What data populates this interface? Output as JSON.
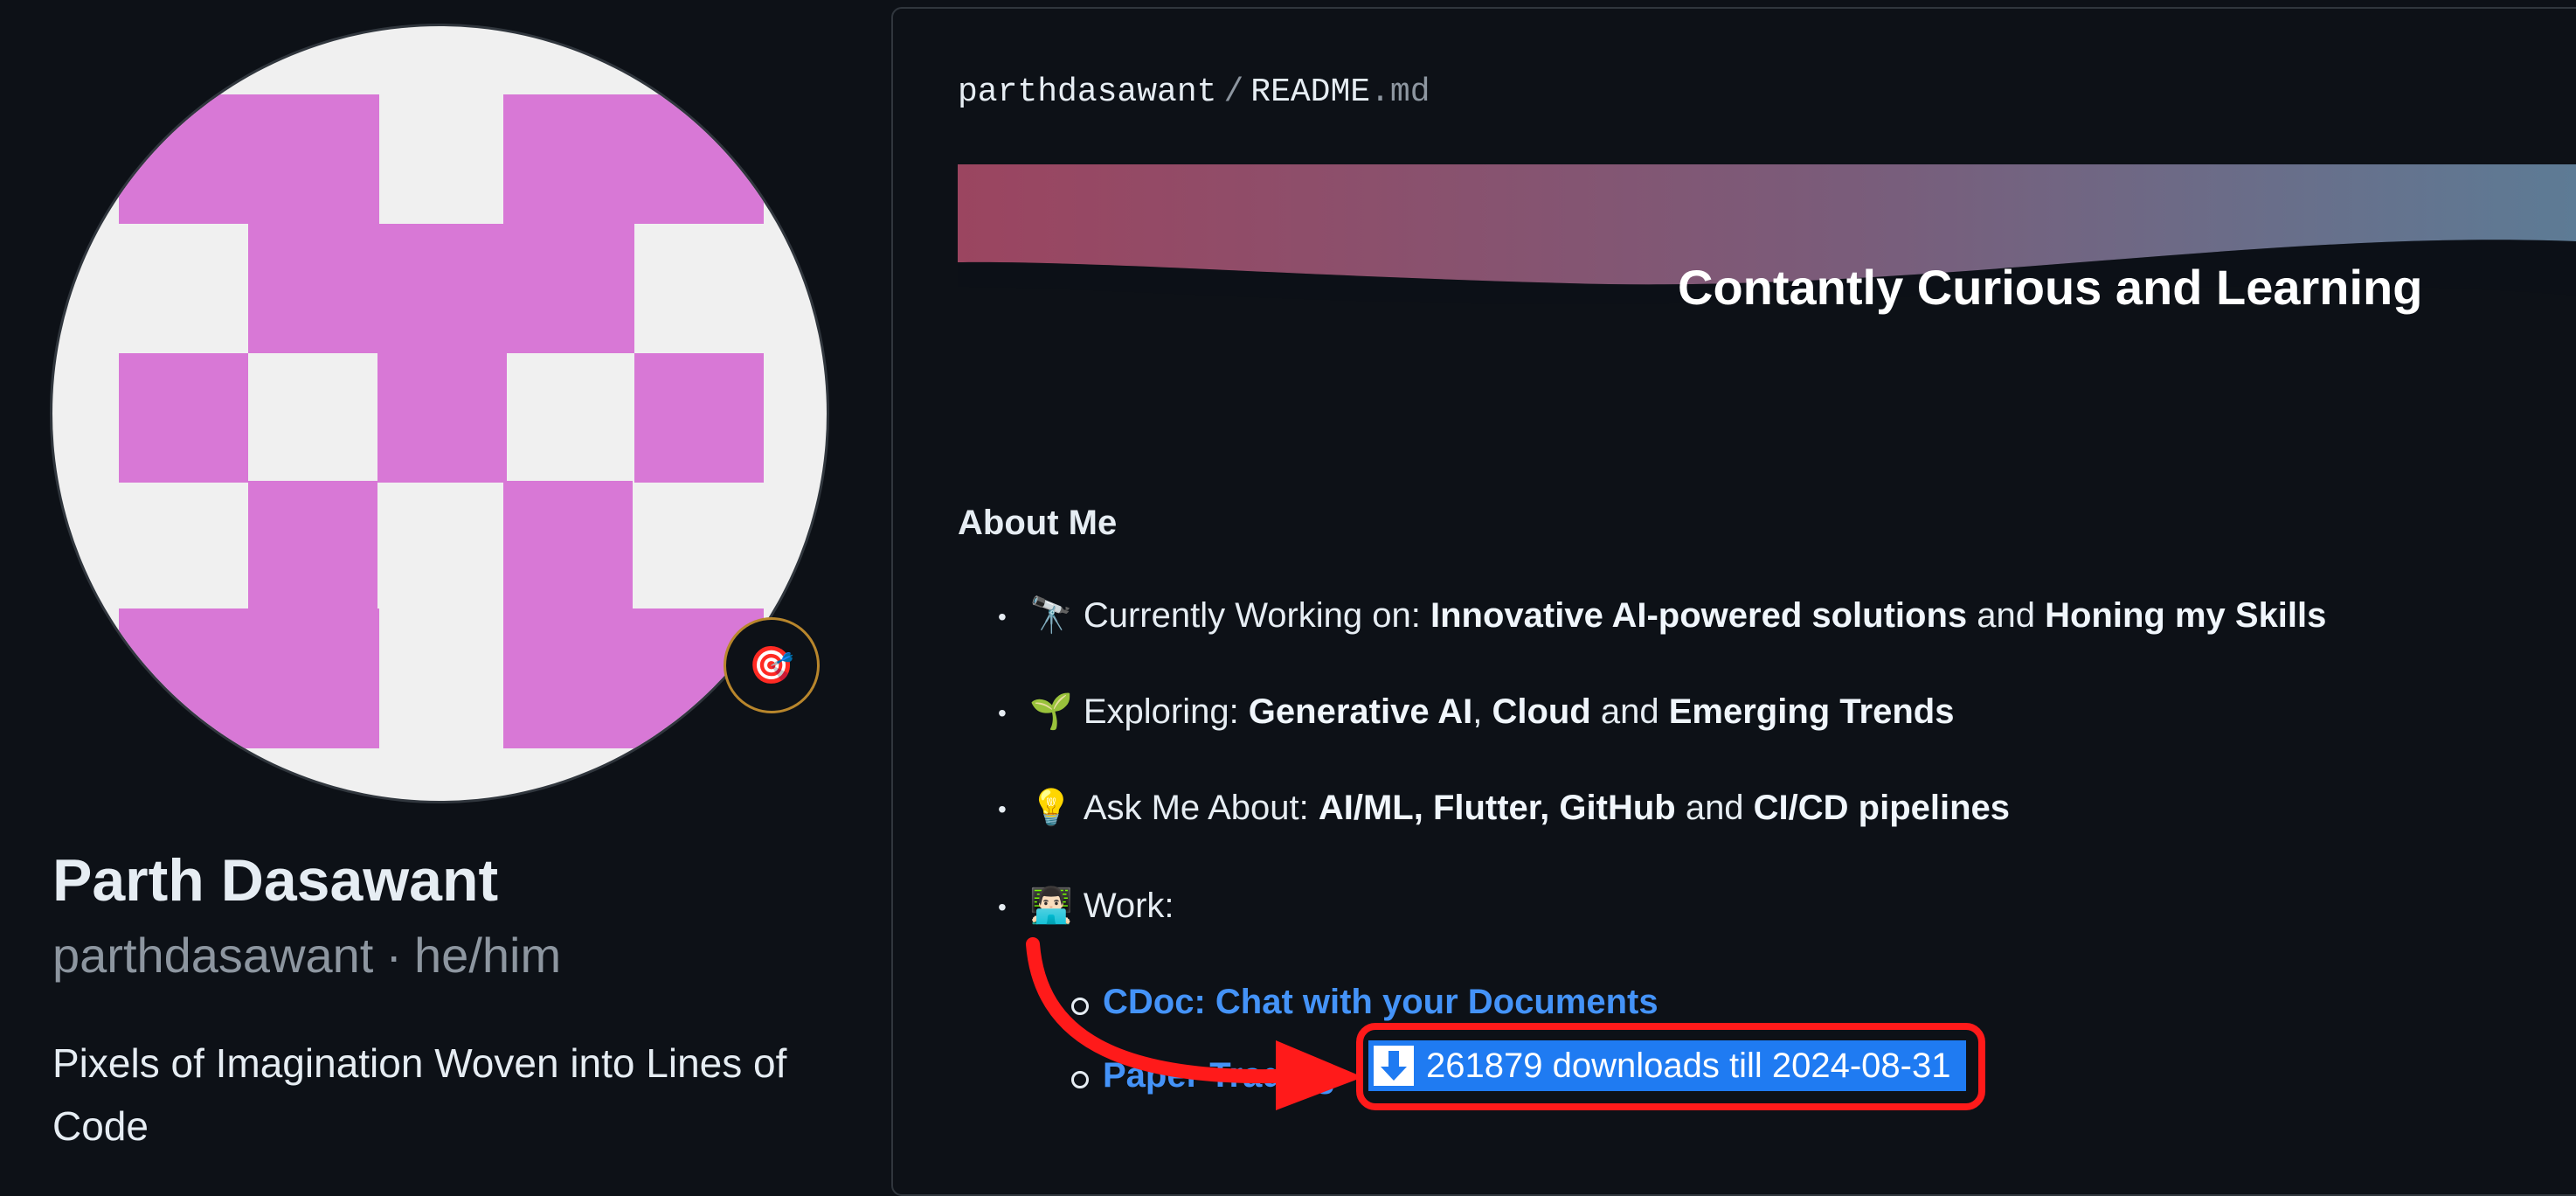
{
  "profile": {
    "name": "Parth Dasawant",
    "login": "parthdasawant",
    "pronouns": "he/him",
    "separator": "·",
    "bio": "Pixels of Imagination Woven into Lines of Code",
    "status_emoji": "🎯",
    "avatar_colors": {
      "fill": "#d878d6",
      "background": "#f0f0f0"
    }
  },
  "readme": {
    "owner": "parthdasawant",
    "slash": "/",
    "filename": "README",
    "extension": ".md",
    "banner_title": "Contantly Curious and Learning",
    "banner_colors": [
      "#9b4560",
      "#7a5c7a",
      "#5d7b95"
    ],
    "about_heading": "About Me",
    "items": [
      {
        "emoji": "🔭",
        "prefix": "Currently Working on: ",
        "b1": "Innovative AI-powered solutions",
        "mid1": " and ",
        "b2": "Honing my Skills"
      },
      {
        "emoji": "🌱",
        "prefix": "Exploring: ",
        "b1": "Generative AI",
        "mid1": ", ",
        "b2": "Cloud",
        "mid2": " and ",
        "b3": "Emerging Trends"
      },
      {
        "emoji": "💡",
        "prefix": "Ask Me About: ",
        "b1": "AI/ML, Flutter, GitHub",
        "mid1": " and ",
        "b2": "CI/CD pipelines"
      },
      {
        "emoji": "👨🏻‍💻",
        "prefix": "Work:"
      }
    ],
    "work_items": [
      {
        "label": "CDoc: Chat with your Documents"
      },
      {
        "label": "Paper Trading"
      }
    ],
    "downloads_badge": {
      "text": "261879 downloads till 2024-08-31",
      "icon": "download-arrow-icon",
      "color": "#1f7bf2"
    },
    "annotation_color": "#ff1a1a"
  },
  "bullet_char": "•"
}
